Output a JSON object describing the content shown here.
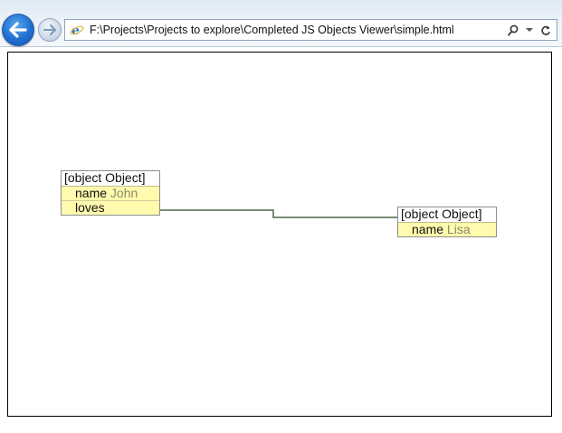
{
  "browser": {
    "address": "F:\\Projects\\Projects to explore\\Completed JS Objects Viewer\\simple.html",
    "icons": [
      "back-arrow-icon",
      "forward-arrow-icon",
      "ie-page-icon",
      "search-icon",
      "dropdown-icon",
      "refresh-icon"
    ]
  },
  "objects": [
    {
      "header": "[object Object]",
      "props": [
        {
          "key": "name",
          "value": "John"
        },
        {
          "key": "loves",
          "value": ""
        }
      ]
    },
    {
      "header": "[object Object]",
      "props": [
        {
          "key": "name",
          "value": "Lisa"
        }
      ]
    }
  ],
  "colors": {
    "box_fill": "#fffaad",
    "connector": "#4a6a4a",
    "value_text": "#8a8a6a"
  }
}
